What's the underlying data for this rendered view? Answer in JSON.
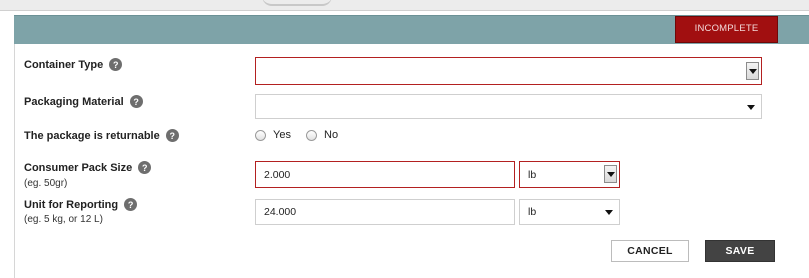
{
  "header": {
    "status_badge": "INCOMPLETE"
  },
  "form": {
    "container_type": {
      "label": "Container Type",
      "value": ""
    },
    "packaging_material": {
      "label": "Packaging Material",
      "value": ""
    },
    "returnable": {
      "label": "The package is returnable",
      "option_yes": "Yes",
      "option_no": "No"
    },
    "consumer_pack_size": {
      "label": "Consumer Pack Size",
      "hint": "(eg. 50gr)",
      "value": "2.000",
      "unit": "lb"
    },
    "unit_for_reporting": {
      "label": "Unit for Reporting",
      "hint": "(eg. 5 kg, or 12 L)",
      "value": "24.000",
      "unit": "lb"
    }
  },
  "actions": {
    "cancel_label": "CANCEL",
    "save_label": "SAVE"
  },
  "icons": {
    "help": "question-mark-icon",
    "dropdown": "chevron-down-icon"
  },
  "colors": {
    "header": "#7ea3a8",
    "badge": "#a10f10",
    "error_border": "#b32020",
    "save_button": "#434343"
  }
}
